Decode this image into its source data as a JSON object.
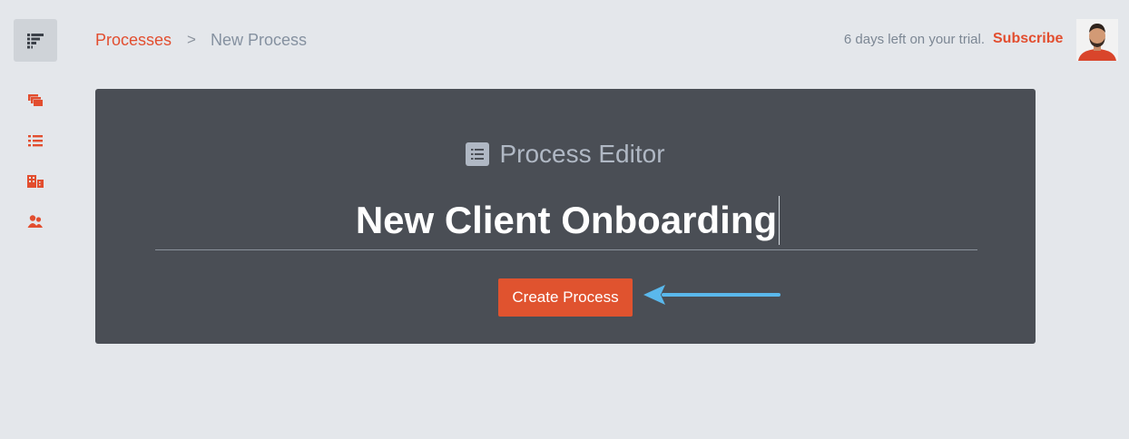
{
  "colors": {
    "accent": "#e24e2f",
    "panel": "#4a4e55",
    "background": "#e4e7eb",
    "callout_arrow": "#5ab8ec"
  },
  "sidebar": {
    "logo_icon": "app-menu-icon",
    "items": [
      {
        "icon": "processes-stack-icon"
      },
      {
        "icon": "checklist-icon"
      },
      {
        "icon": "buildings-icon"
      },
      {
        "icon": "users-icon"
      }
    ]
  },
  "header": {
    "breadcrumb": {
      "parent": "Processes",
      "separator": ">",
      "current": "New Process"
    },
    "trial_text": "6 days left on your trial.",
    "subscribe_label": "Subscribe",
    "avatar_icon": "user-avatar"
  },
  "editor": {
    "heading": "Process Editor",
    "heading_icon": "list-icon",
    "title_value": "New Client Onboarding",
    "create_label": "Create Process"
  }
}
